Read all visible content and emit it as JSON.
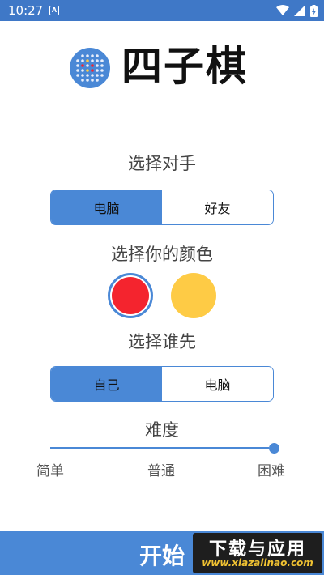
{
  "status_bar": {
    "time": "10:27",
    "notification_badge": "A",
    "icons": [
      "wifi-icon",
      "signal-icon",
      "battery-icon"
    ]
  },
  "app": {
    "title": "四子棋",
    "logo_icon": "connect-four-board-icon"
  },
  "opponent": {
    "title": "选择对手",
    "options": [
      "电脑",
      "好友"
    ],
    "selected_index": 0
  },
  "color": {
    "title": "选择你的颜色",
    "options": [
      {
        "name": "red",
        "hex": "#f4242e"
      },
      {
        "name": "yellow",
        "hex": "#fecb45"
      }
    ],
    "selected_index": 0
  },
  "first_move": {
    "title": "选择谁先",
    "options": [
      "自己",
      "电脑"
    ],
    "selected_index": 0
  },
  "difficulty": {
    "title": "难度",
    "levels": [
      "简单",
      "普通",
      "困难"
    ],
    "value_fraction": 1.0
  },
  "start_button": {
    "label": "开始"
  },
  "watermark": {
    "title": "下载与应用",
    "url": "www.xiazaiinao.com"
  },
  "colors": {
    "status_bar": "#3f78c7",
    "accent": "#4a88d6"
  }
}
